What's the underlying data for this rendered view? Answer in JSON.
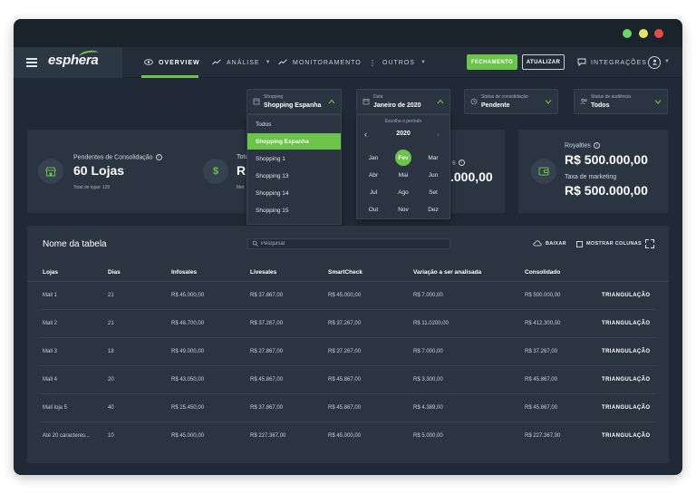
{
  "nav": {
    "brand": "esphera",
    "items": [
      {
        "label": "OVERVIEW"
      },
      {
        "label": "ANÁLISE"
      },
      {
        "label": "MONITORAMENTO"
      },
      {
        "label": "OUTROS"
      }
    ],
    "fechamento_label": "FECHAMENTO",
    "atualizar_label": "ATUALIZAR",
    "integracoes_label": "INTEGRAÇÕES"
  },
  "filters": {
    "shopping": {
      "label": "Shopping",
      "value": "Shopping Espanha"
    },
    "data": {
      "label": "Data",
      "value": "Janeiro de 2020"
    },
    "consolidacao": {
      "label": "Status de consolidação",
      "value": "Pendente"
    },
    "audiencia": {
      "label": "Status de audiência",
      "value": "Todos"
    }
  },
  "shopping_dropdown": {
    "options": [
      "Todos",
      "Shopping Espanha",
      "Shopping 1",
      "Shopping 13",
      "Shopping 14",
      "Shopping 15"
    ],
    "selected": "Shopping Espanha"
  },
  "date_picker": {
    "period_label": "Escolha o período",
    "year": "2020",
    "months": [
      "Jan",
      "Fev",
      "Mar",
      "Abr",
      "Mai",
      "Jun",
      "Jul",
      "Ago",
      "Set",
      "Out",
      "Nov",
      "Dez"
    ],
    "selected": "Fev"
  },
  "cards": {
    "pendentes": {
      "label": "Pendentes de Consolidação",
      "value": "60 Lojas",
      "sub": "Total de lojas: 120"
    },
    "card2": {
      "label_partial": "Tota",
      "value_partial": "R",
      "sub_partial": "Met"
    },
    "card3": {
      "label_partial": "s",
      "value_partial": ".000,00"
    },
    "royalties": {
      "label": "Royalties",
      "value": "R$ 500.000,00",
      "label2": "Taxa de marketing",
      "value2": "R$ 500.000,00"
    }
  },
  "table": {
    "title": "Nome da tabela",
    "search_placeholder": "Pesquisar",
    "baixar_label": "BAIXAR",
    "mostrar_label": "MOSTRAR COLUNAS",
    "columns": [
      "Lojas",
      "Dias",
      "Infosales",
      "Livesales",
      "SmartCheck",
      "Variação a ser analisada",
      "Consolidado"
    ],
    "rows": [
      [
        "Mall 1",
        "21",
        "R$ 45.000,00",
        "R$ 37.867,00",
        "R$ 45.000,00",
        "R$ 7.000,00",
        "R$ 500.000,00",
        "TRIANGULAÇÃO"
      ],
      [
        "Mall 2",
        "21",
        "R$ 48.700,00",
        "R$ 37.267,00",
        "R$ 37.267,00",
        "R$ 11.0200,00",
        "R$ 412.300,00",
        "TRIANGULAÇÃO"
      ],
      [
        "Mall 3",
        "18",
        "R$ 49.000,00",
        "R$ 27.867,00",
        "R$ 37.267,00",
        "R$ 7.000,00",
        "R$ 37.267,00",
        "TRIANGULAÇÃO"
      ],
      [
        "Mall 4",
        "20",
        "R$ 43.050,00",
        "R$ 45.867,00",
        "R$ 45.867,00",
        "R$ 3.300,00",
        "R$ 45.867,00",
        "TRIANGULAÇÃO"
      ],
      [
        "Mall loja 5",
        "40",
        "R$ 25.450,00",
        "R$ 37.867,00",
        "R$ 45.867,00",
        "R$ 4.389,00",
        "R$ 45.867,00",
        "TRIANGULAÇÃO"
      ],
      [
        "Até 20 caracteres...",
        "10",
        "R$ 45.000,00",
        "R$ 227.367,00",
        "R$ 45.000,00",
        "R$ 5.000,00",
        "R$ 227.367,00",
        "TRIANGULAÇÃO"
      ]
    ]
  },
  "colors": {
    "accent": "#6bc349",
    "background": "#202a36",
    "panel": "#2b3542"
  }
}
